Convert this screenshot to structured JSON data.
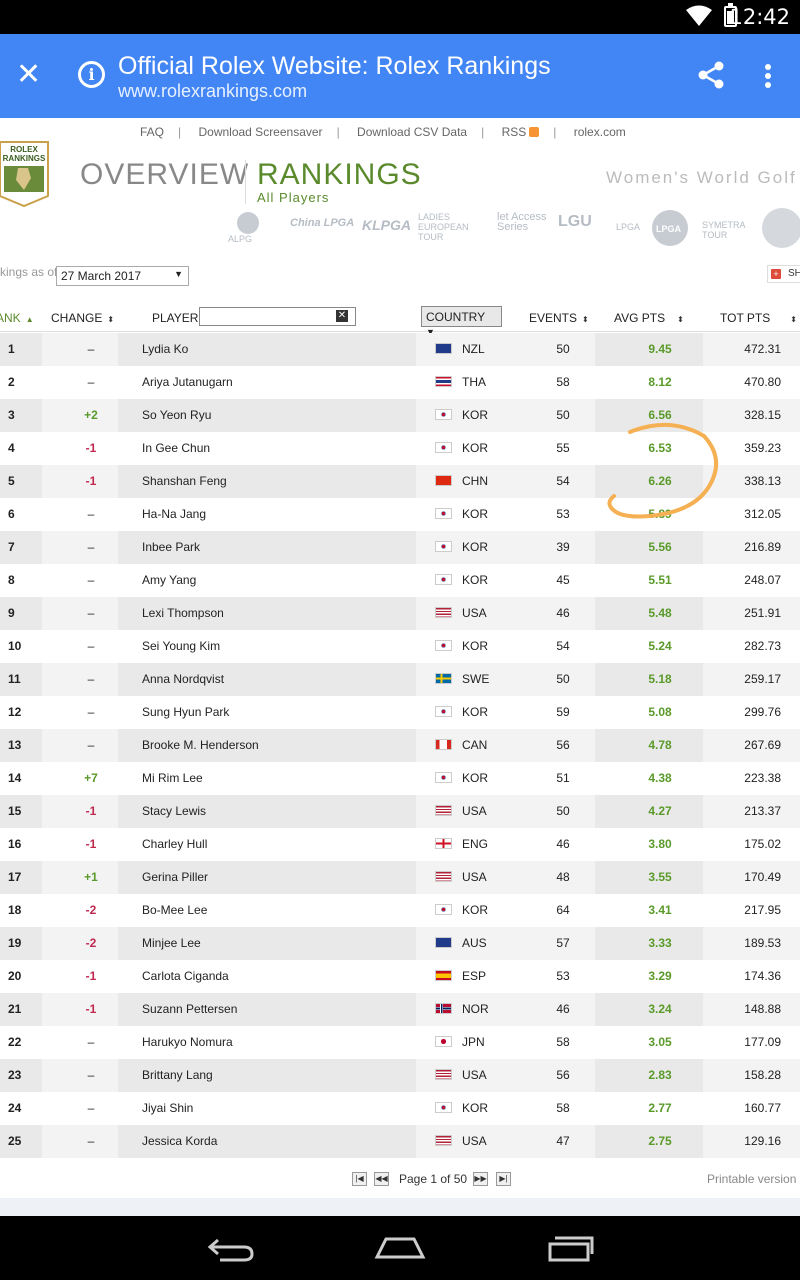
{
  "status_bar": {
    "time": "12:42"
  },
  "browser": {
    "title": "Official Rolex Website: Rolex Rankings",
    "url": "www.rolexrankings.com"
  },
  "top_nav": [
    "FAQ",
    "Download Screensaver",
    "Download CSV Data",
    "RSS",
    "rolex.com"
  ],
  "logo": {
    "line1": "ROLEX",
    "line2": "RANKINGS"
  },
  "header": {
    "overview": "OVERVIEW",
    "rankings": "RANKINGS",
    "subtitle": "All Players",
    "tagline": "Women's World Golf"
  },
  "tours": {
    "alpg": "ALPG",
    "china_lpga": "China LPGA",
    "klpga": "KLPGA",
    "let": "LADIES EUROPEAN TOUR",
    "let_access": "let Access Series",
    "lgu": "LGU",
    "lpga_japan": "LPGA",
    "lpga": "LPGA",
    "symetra": "SYMETRA TOUR"
  },
  "filters": {
    "rankings_as_of_label": "kings as of",
    "date_value": "27 March 2017",
    "share_label": "SH"
  },
  "table": {
    "headers": {
      "rank": "ANK",
      "change": "CHANGE",
      "player": "PLAYER",
      "country": "COUNTRY",
      "events": "EVENTS",
      "avg_pts": "AVG PTS",
      "tot_pts": "TOT PTS"
    },
    "player_search_value": "",
    "rows": [
      {
        "rank": "1",
        "change": "–",
        "player": "Lydia Ko",
        "country": "NZL",
        "events": "50",
        "avg": "9.45",
        "tot": "472.31"
      },
      {
        "rank": "2",
        "change": "–",
        "player": "Ariya Jutanugarn",
        "country": "THA",
        "events": "58",
        "avg": "8.12",
        "tot": "470.80"
      },
      {
        "rank": "3",
        "change": "+2",
        "player": "So Yeon Ryu",
        "country": "KOR",
        "events": "50",
        "avg": "6.56",
        "tot": "328.15"
      },
      {
        "rank": "4",
        "change": "-1",
        "player": "In Gee Chun",
        "country": "KOR",
        "events": "55",
        "avg": "6.53",
        "tot": "359.23"
      },
      {
        "rank": "5",
        "change": "-1",
        "player": "Shanshan Feng",
        "country": "CHN",
        "events": "54",
        "avg": "6.26",
        "tot": "338.13"
      },
      {
        "rank": "6",
        "change": "–",
        "player": "Ha-Na Jang",
        "country": "KOR",
        "events": "53",
        "avg": "5.89",
        "tot": "312.05"
      },
      {
        "rank": "7",
        "change": "–",
        "player": "Inbee Park",
        "country": "KOR",
        "events": "39",
        "avg": "5.56",
        "tot": "216.89"
      },
      {
        "rank": "8",
        "change": "–",
        "player": "Amy Yang",
        "country": "KOR",
        "events": "45",
        "avg": "5.51",
        "tot": "248.07"
      },
      {
        "rank": "9",
        "change": "–",
        "player": "Lexi Thompson",
        "country": "USA",
        "events": "46",
        "avg": "5.48",
        "tot": "251.91"
      },
      {
        "rank": "10",
        "change": "–",
        "player": "Sei Young Kim",
        "country": "KOR",
        "events": "54",
        "avg": "5.24",
        "tot": "282.73"
      },
      {
        "rank": "11",
        "change": "–",
        "player": "Anna Nordqvist",
        "country": "SWE",
        "events": "50",
        "avg": "5.18",
        "tot": "259.17"
      },
      {
        "rank": "12",
        "change": "–",
        "player": "Sung Hyun Park",
        "country": "KOR",
        "events": "59",
        "avg": "5.08",
        "tot": "299.76"
      },
      {
        "rank": "13",
        "change": "–",
        "player": "Brooke M. Henderson",
        "country": "CAN",
        "events": "56",
        "avg": "4.78",
        "tot": "267.69"
      },
      {
        "rank": "14",
        "change": "+7",
        "player": "Mi Rim Lee",
        "country": "KOR",
        "events": "51",
        "avg": "4.38",
        "tot": "223.38"
      },
      {
        "rank": "15",
        "change": "-1",
        "player": "Stacy Lewis",
        "country": "USA",
        "events": "50",
        "avg": "4.27",
        "tot": "213.37"
      },
      {
        "rank": "16",
        "change": "-1",
        "player": "Charley Hull",
        "country": "ENG",
        "events": "46",
        "avg": "3.80",
        "tot": "175.02"
      },
      {
        "rank": "17",
        "change": "+1",
        "player": "Gerina Piller",
        "country": "USA",
        "events": "48",
        "avg": "3.55",
        "tot": "170.49"
      },
      {
        "rank": "18",
        "change": "-2",
        "player": "Bo-Mee Lee",
        "country": "KOR",
        "events": "64",
        "avg": "3.41",
        "tot": "217.95"
      },
      {
        "rank": "19",
        "change": "-2",
        "player": "Minjee Lee",
        "country": "AUS",
        "events": "57",
        "avg": "3.33",
        "tot": "189.53"
      },
      {
        "rank": "20",
        "change": "-1",
        "player": "Carlota Ciganda",
        "country": "ESP",
        "events": "53",
        "avg": "3.29",
        "tot": "174.36"
      },
      {
        "rank": "21",
        "change": "-1",
        "player": "Suzann Pettersen",
        "country": "NOR",
        "events": "46",
        "avg": "3.24",
        "tot": "148.88"
      },
      {
        "rank": "22",
        "change": "–",
        "player": "Harukyo Nomura",
        "country": "JPN",
        "events": "58",
        "avg": "3.05",
        "tot": "177.09"
      },
      {
        "rank": "23",
        "change": "–",
        "player": "Brittany Lang",
        "country": "USA",
        "events": "56",
        "avg": "2.83",
        "tot": "158.28"
      },
      {
        "rank": "24",
        "change": "–",
        "player": "Jiyai Shin",
        "country": "KOR",
        "events": "58",
        "avg": "2.77",
        "tot": "160.77"
      },
      {
        "rank": "25",
        "change": "–",
        "player": "Jessica Korda",
        "country": "USA",
        "events": "47",
        "avg": "2.75",
        "tot": "129.16"
      }
    ]
  },
  "pager": {
    "text": "Page 1 of 50",
    "printable": "Printable version o"
  },
  "colors": {
    "appbar": "#4285f4",
    "rankings_green": "#5a8a2c",
    "positive_change": "#5a9a2a",
    "negative_change": "#c0284e",
    "annotation_circle": "#f5b053"
  }
}
